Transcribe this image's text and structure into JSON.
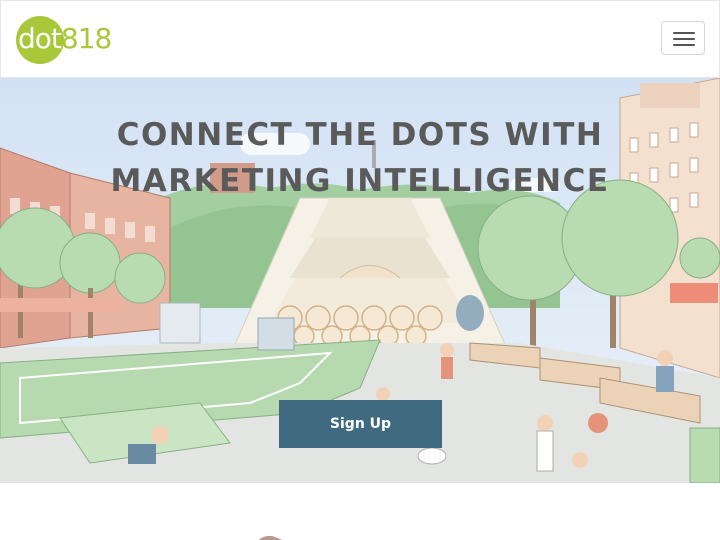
{
  "navbar": {
    "logo": {
      "prefix": "dot",
      "number": "818",
      "icon": "dot818-logo"
    },
    "menu_toggle": {
      "icon": "hamburger-menu-icon"
    }
  },
  "hero": {
    "title": "CONNECT THE DOTS WITH MARKETING INTELLIGENCE",
    "cta_label": "Sign Up",
    "background": "illustrated-city-cascade-scene"
  },
  "colors": {
    "brand_green": "#a8c83a",
    "button_blue": "#3f6a80",
    "title_gray": "#5a5a5a"
  }
}
